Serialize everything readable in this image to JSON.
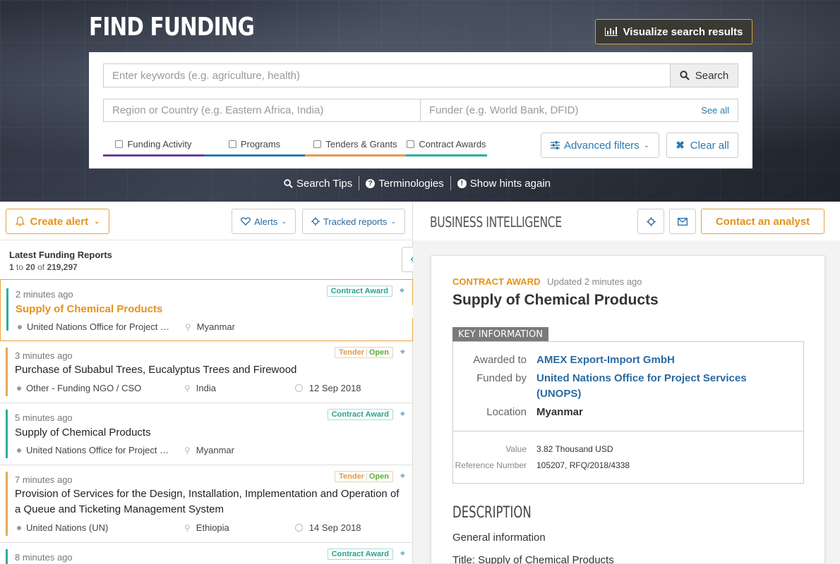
{
  "header": {
    "title": "FIND FUNDING",
    "visualize_label": "Visualize search results"
  },
  "search": {
    "keyword_placeholder": "Enter keywords (e.g. agriculture, health)",
    "search_label": "Search",
    "region_placeholder": "Region or Country (e.g. Eastern Africa, India)",
    "funder_placeholder": "Funder (e.g. World Bank, DFID)",
    "see_all": "See all",
    "filters": [
      "Funding Activity",
      "Programs",
      "Tenders & Grants",
      "Contract Awards"
    ],
    "advanced_label": "Advanced filters",
    "clear_label": "Clear all"
  },
  "hints": {
    "search_tips": "Search Tips",
    "terminologies": "Terminologies",
    "show_hints": "Show hints again"
  },
  "toolbar": {
    "create_alert": "Create alert",
    "alerts": "Alerts",
    "tracked_reports": "Tracked reports"
  },
  "list": {
    "title": "Latest Funding Reports",
    "range_from": "1",
    "range_word": "to",
    "range_to": "20",
    "of_word": "of",
    "total": "219,297",
    "items": [
      {
        "time": "2 minutes ago",
        "title": "Supply of Chemical Products",
        "org": "United Nations Office for Project Services (UNOPS)",
        "location": "Myanmar",
        "date": "",
        "badge": "Contract Award",
        "badge_type": "award",
        "bar_color": "#2aaf9c"
      },
      {
        "time": "3 minutes ago",
        "title": "Purchase of Subabul Trees, Eucalyptus Trees and Firewood",
        "org": "Other - Funding NGO / CSO",
        "location": "India",
        "date": "12 Sep 2018",
        "badge": "Tender",
        "badge_status": "Open",
        "badge_type": "tender",
        "bar_color": "#e5a85a"
      },
      {
        "time": "5 minutes ago",
        "title": "Supply of Chemical Products",
        "org": "United Nations Office for Project Services (UNOPS)",
        "location": "Myanmar",
        "date": "",
        "badge": "Contract Award",
        "badge_type": "award",
        "bar_color": "#2aaf9c"
      },
      {
        "time": "7 minutes ago",
        "title": "Provision of Services for the Design, Installation, Implementation and Operation of a Queue and Ticketing Management System",
        "org": "United Nations (UN)",
        "location": "Ethiopia",
        "date": "14 Sep 2018",
        "badge": "Tender",
        "badge_status": "Open",
        "badge_type": "tender",
        "bar_color": "#e5a85a"
      },
      {
        "time": "8 minutes ago",
        "title": "",
        "org": "",
        "location": "",
        "date": "",
        "badge": "Contract Award",
        "badge_type": "award",
        "bar_color": "#2aaf9c"
      }
    ]
  },
  "detail": {
    "section_title": "BUSINESS INTELLIGENCE",
    "contact_label": "Contact an analyst",
    "type": "CONTRACT AWARD",
    "updated": "Updated 2 minutes ago",
    "title": "Supply of Chemical Products",
    "key_info_label": "KEY INFORMATION",
    "awarded_to_label": "Awarded to",
    "awarded_to": "AMEX Export-Import GmbH",
    "funded_by_label": "Funded by",
    "funded_by_1": "United Nations Office for Project Services",
    "funded_by_2": "(UNOPS)",
    "location_label": "Location",
    "location": "Myanmar",
    "value_label": "Value",
    "value": "3.82 Thousand USD",
    "reference_label": "Reference Number",
    "reference": "105207, RFQ/2018/4338",
    "description_title": "DESCRIPTION",
    "general_info": "General information",
    "title_line": "Title: Supply of Chemical Products"
  },
  "colors": {
    "accent_orange": "#e5921a",
    "link_blue": "#2a6aa0",
    "award_teal": "#2aaf9c",
    "tender_orange": "#e59a46",
    "funding_purple": "#6a3d9a"
  }
}
